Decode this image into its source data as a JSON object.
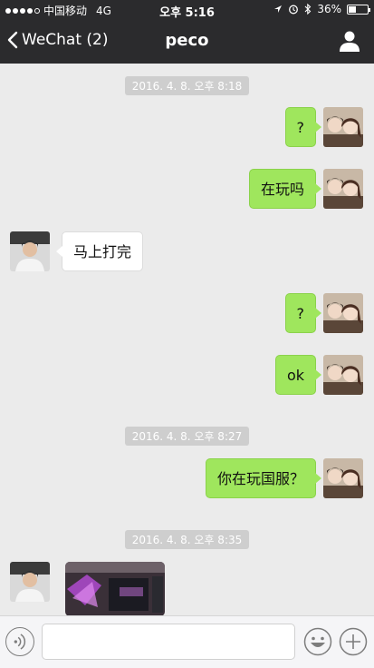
{
  "status_bar": {
    "carrier": "中国移动",
    "network": "4G",
    "time": "오후 5:16",
    "battery": "36%",
    "battery_level": 0.36
  },
  "nav": {
    "back_label": "WeChat (2)",
    "title": "peco"
  },
  "messages": {
    "ts1": "2016. 4. 8. 오후 8:18",
    "m1": "?",
    "m2": "在玩吗",
    "m3": "马上打完",
    "m4": "?",
    "m5": "ok",
    "ts2": "2016. 4. 8. 오후 8:27",
    "m6": "你在玩国服？",
    "ts3": "2016. 4. 8. 오후 8:35"
  },
  "input": {
    "value": "",
    "placeholder": ""
  },
  "colors": {
    "nav_bg": "#2b2b2d",
    "chat_bg": "#ebebeb",
    "outgoing_bubble": "#9fe65d",
    "incoming_bubble": "#ffffff"
  }
}
